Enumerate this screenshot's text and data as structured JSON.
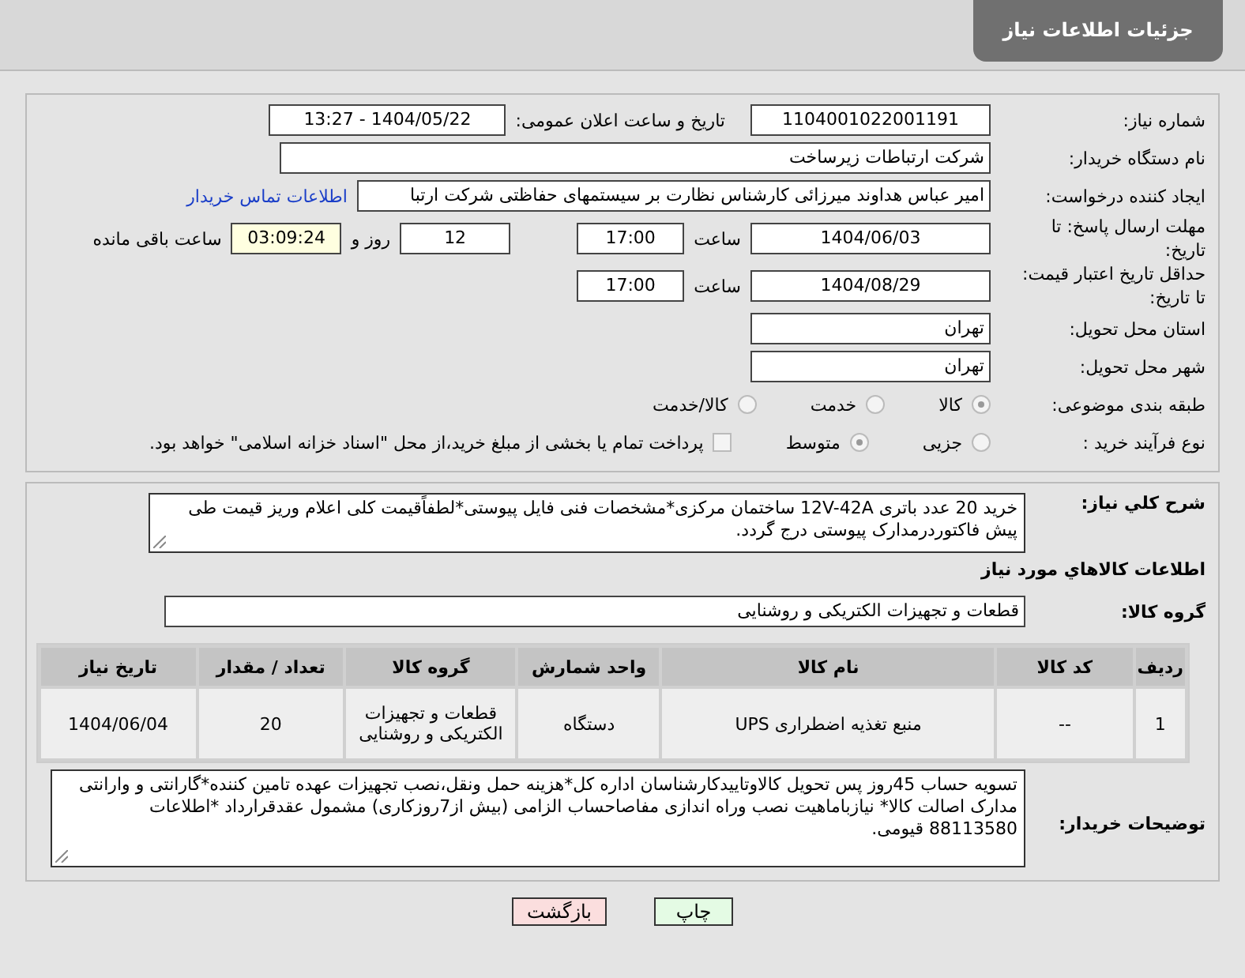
{
  "header": {
    "title": "جزئیات اطلاعات نیاز"
  },
  "need_number": {
    "label": "شماره نیاز:",
    "value": "1104001022001191"
  },
  "announce": {
    "label": "تاریخ و ساعت اعلان عمومی:",
    "value": "1404/05/22 - 13:27"
  },
  "buyer_org": {
    "label": "نام دستگاه خریدار:",
    "value": "شرکت ارتباطات زیرساخت"
  },
  "requester": {
    "label": "ایجاد کننده درخواست:",
    "value": "امیر عباس هداوند میرزائی کارشناس نظارت بر سیستمهای حفاظتی شرکت ارتبا",
    "link": "اطلاعات تماس خریدار"
  },
  "response_deadline": {
    "label": "مهلت ارسال پاسخ: تا تاریخ:",
    "date": "1404/06/03",
    "time_label": "ساعت",
    "time": "17:00",
    "days": "12",
    "days_label": "روز و",
    "remaining": "03:09:24",
    "remaining_label": "ساعت باقی مانده"
  },
  "validity": {
    "label": "حداقل تاریخ اعتبار قیمت: تا تاریخ:",
    "date": "1404/08/29",
    "time_label": "ساعت",
    "time": "17:00"
  },
  "province": {
    "label": "استان محل تحویل:",
    "value": "تهران"
  },
  "city": {
    "label": "شهر محل تحویل:",
    "value": "تهران"
  },
  "category": {
    "label": "طبقه بندی موضوعی:",
    "options": [
      {
        "label": "کالا",
        "selected": true
      },
      {
        "label": "خدمت",
        "selected": false
      },
      {
        "label": "کالا/خدمت",
        "selected": false
      }
    ]
  },
  "purchase_process": {
    "label": "نوع فرآیند خرید :",
    "options": [
      {
        "label": "جزیی",
        "selected": false
      },
      {
        "label": "متوسط",
        "selected": true
      }
    ],
    "payment": {
      "checked": false,
      "text": "پرداخت تمام یا بخشی از مبلغ خرید،از محل \"اسناد خزانه اسلامی\" خواهد بود."
    }
  },
  "description": {
    "label": "شرح کلي نياز:",
    "value": "خرید 20 عدد باتری 12V-42A ساختمان مرکزی*مشخصات فنی فایل پیوستی*لطفاًقیمت کلی اعلام وریز قیمت طی پیش فاکتوردرمدارک پیوستی درج گردد."
  },
  "goods_heading": "اطلاعات کالاهاي مورد نياز",
  "goods_group": {
    "label": "گروه کالا:",
    "value": "قطعات و تجهیزات الکتریکی و روشنایی"
  },
  "table": {
    "columns": [
      "ردیف",
      "کد کالا",
      "نام کالا",
      "واحد شمارش",
      "گروه کالا",
      "تعداد / مقدار",
      "تاریخ نیاز"
    ],
    "rows": [
      [
        "1",
        "--",
        "منبع تغذیه اضطراری UPS",
        "دستگاه",
        "قطعات و تجهیزات الکتریکی و روشنایی",
        "20",
        "1404/06/04"
      ]
    ]
  },
  "buyer_notes": {
    "label": "توضیحات خریدار:",
    "value": "تسویه حساب 45روز پس تحویل کالاوتاییدکارشناسان  اداره کل*هزینه حمل ونقل،نصب تجهیزات عهده تامین کننده*گارانتی و وارانتی مدارک اصالت کالا* نیازباماهیت نصب وراه اندازی مفاصاحساب الزامی (بیش از7روزکاری) مشمول عقدقرارداد *اطلاعات 88113580 قیومی."
  },
  "buttons": [
    {
      "label": "چاپ",
      "kind": "print"
    },
    {
      "label": "بازگشت",
      "kind": "back"
    }
  ]
}
